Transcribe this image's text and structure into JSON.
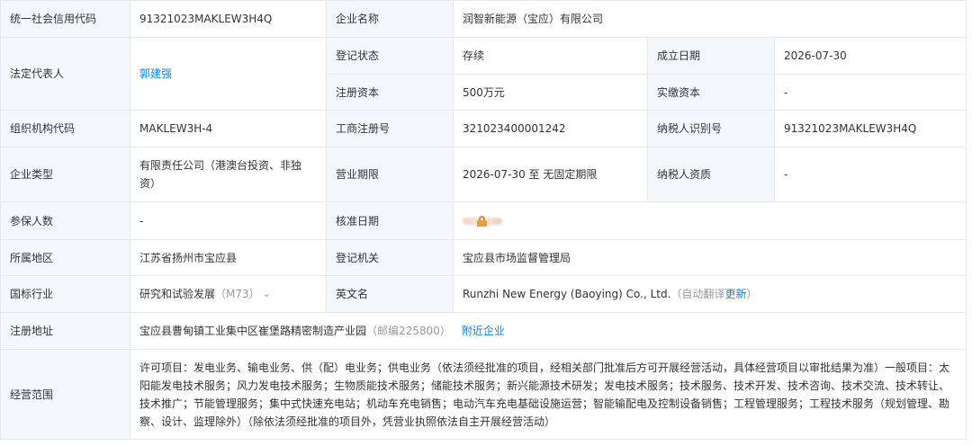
{
  "credit_code": {
    "label": "统一社会信用代码",
    "value": "91321023MAKLEW3H4Q"
  },
  "company_name": {
    "label": "企业名称",
    "value": "润智新能源（宝应）有限公司"
  },
  "legal_rep": {
    "label": "法定代表人",
    "value": "郭建强"
  },
  "reg_status": {
    "label": "登记状态",
    "value": "存续"
  },
  "est_date": {
    "label": "成立日期",
    "value": "2026-07-30"
  },
  "reg_capital": {
    "label": "注册资本",
    "value": "500万元"
  },
  "paid_capital": {
    "label": "实缴资本",
    "value": "-"
  },
  "org_code": {
    "label": "组织机构代码",
    "value": "MAKLEW3H-4"
  },
  "biz_reg_no": {
    "label": "工商注册号",
    "value": "321023400001242"
  },
  "taxpayer_id": {
    "label": "纳税人识别号",
    "value": "91321023MAKLEW3H4Q"
  },
  "company_type": {
    "label": "企业类型",
    "value": "有限责任公司（港澳台投资、非独资）"
  },
  "biz_term": {
    "label": "营业期限",
    "value": "2026-07-30 至 无固定期限"
  },
  "taxpayer_qual": {
    "label": "纳税人资质",
    "value": "-"
  },
  "insured": {
    "label": "参保人数",
    "value": "-"
  },
  "approval_date": {
    "label": "核准日期"
  },
  "region": {
    "label": "所属地区",
    "value": "江苏省扬州市宝应县"
  },
  "reg_authority": {
    "label": "登记机关",
    "value": "宝应县市场监督管理局"
  },
  "industry": {
    "label": "国标行业",
    "value": "研究和试验发展",
    "code": "（M73）"
  },
  "english_name": {
    "label": "英文名",
    "value": "Runzhi New Energy (Baoying) Co., Ltd.",
    "auto_prefix": "（自动翻译",
    "update_link": "更新",
    "auto_suffix": "）"
  },
  "address": {
    "label": "注册地址",
    "value": "宝应县曹甸镇工业集中区崔堡路精密制造产业园",
    "postcode": "（邮编225800）",
    "nearby_link": "附近企业"
  },
  "business_scope": {
    "label": "经营范围",
    "value": "许可项目：发电业务、输电业务、供（配）电业务；供电业务（依法须经批准的项目，经相关部门批准后方可开展经营活动，具体经营项目以审批结果为准）一般项目：太阳能发电技术服务；风力发电技术服务；生物质能技术服务；储能技术服务；新兴能源技术研发；发电技术服务；技术服务、技术开发、技术咨询、技术交流、技术转让、技术推广；节能管理服务；集中式快速充电站；机动车充电销售；电动汽车充电基础设施运营；智能输配电及控制设备销售；工程管理服务；工程技术服务（规划管理、勘察、设计、监理除外）（除依法须经批准的项目外，凭营业执照依法自主开展经营活动）"
  }
}
